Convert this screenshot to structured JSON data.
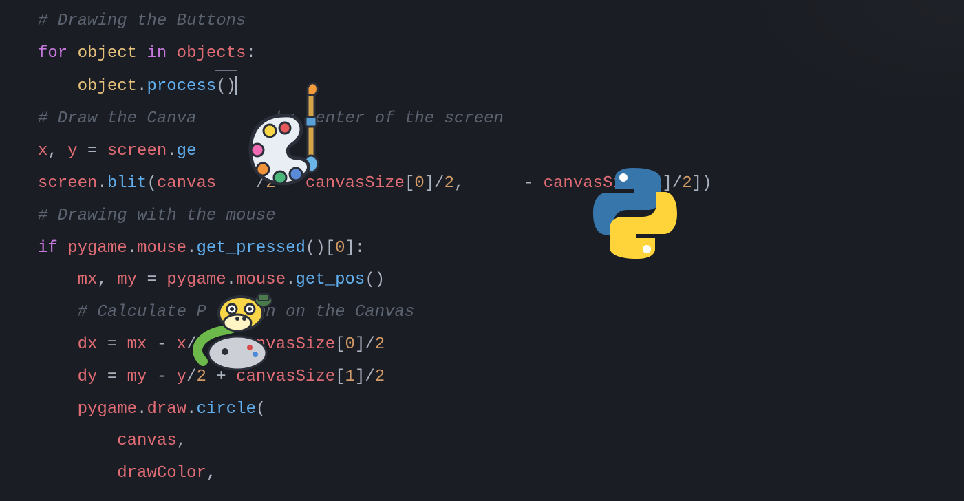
{
  "code": {
    "line1_comment": "# Drawing the Buttons",
    "line2_for": "for",
    "line2_object": "object",
    "line2_in": "in",
    "line2_objects": "objects",
    "line2_colon": ":",
    "line3_object": "object",
    "line3_dot": ".",
    "line3_process": "process",
    "line3_parens": "()",
    "line4_comment_a": "# Draw the Canva",
    "line4_comment_b": "he center of the screen",
    "line5_x": "x",
    "line5_comma": ", ",
    "line5_y": "y",
    "line5_eq": " = ",
    "line5_screen": "screen",
    "line5_dot": ".",
    "line5_ge": "ge",
    "line5_parens": "()",
    "line6_screen": "screen",
    "line6_blit": "blit",
    "line6_canvas": "canvas",
    "line6_two_a": "2",
    "line6_canvassize_a": "canvasSize",
    "line6_zero": "0",
    "line6_two_b": "2",
    "line6_canvassize_b": "canvasSize",
    "line6_one": "1",
    "line6_two_c": "2",
    "line7_comment": "# Drawing with the mouse",
    "line8_if": "if",
    "line8_pygame": "pygame",
    "line8_mouse": "mouse",
    "line8_getpressed": "get_pressed",
    "line8_zero": "0",
    "line9_mx": "mx",
    "line9_my": "my",
    "line9_pygame": "pygame",
    "line9_mouse": "mouse",
    "line9_getpos": "get_pos",
    "line10_comment_a": "# Calculate P",
    "line10_comment_b": "on on the Canvas",
    "line11_dx": "dx",
    "line11_mx": "mx",
    "line11_x": "x",
    "line11_canvassize": "anvasSize",
    "line11_zero": "0",
    "line11_two": "2",
    "line12_dy": "dy",
    "line12_my": "my",
    "line12_y": "y",
    "line12_two_a": "2",
    "line12_canvassize": "canvasSize",
    "line12_one": "1",
    "line12_two_b": "2",
    "line13_pygame": "pygame",
    "line13_draw": "draw",
    "line13_circle": "circle",
    "line14_canvas": "canvas",
    "line15_drawcolor": "drawColor"
  },
  "icons": {
    "palette": "palette-brush-icon",
    "python": "python-logo-icon",
    "pygame": "pygame-snake-icon"
  }
}
